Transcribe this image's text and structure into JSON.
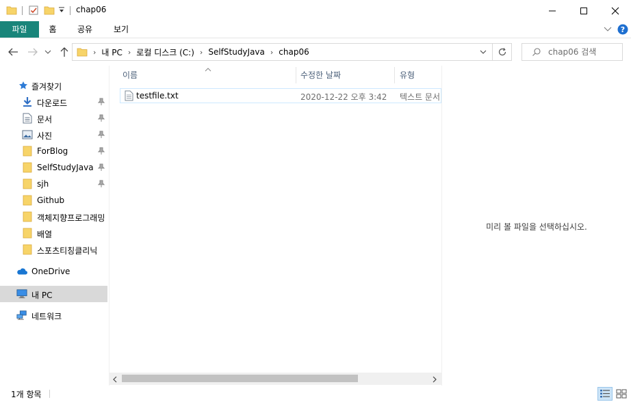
{
  "window": {
    "title": "chap06",
    "minimize_icon": "minimize-icon",
    "maximize_icon": "maximize-icon",
    "close_icon": "close-icon"
  },
  "ribbon": {
    "tabs": [
      {
        "label": "파일"
      },
      {
        "label": "홈"
      },
      {
        "label": "공유"
      },
      {
        "label": "보기"
      }
    ]
  },
  "address": {
    "crumbs": [
      "내 PC",
      "로컬 디스크 (C:)",
      "SelfStudyJava",
      "chap06"
    ]
  },
  "search": {
    "placeholder": "chap06 검색"
  },
  "nav": {
    "quick_access": "즐겨찾기",
    "items": [
      {
        "label": "다운로드",
        "icon": "download-icon"
      },
      {
        "label": "문서",
        "icon": "document-icon"
      },
      {
        "label": "사진",
        "icon": "picture-icon"
      },
      {
        "label": "ForBlog",
        "icon": "folder-icon"
      },
      {
        "label": "SelfStudyJava",
        "icon": "folder-icon"
      },
      {
        "label": "sjh",
        "icon": "folder-icon"
      },
      {
        "label": "Github",
        "icon": "folder-icon"
      },
      {
        "label": "객체지향프로그래밍",
        "icon": "folder-icon"
      },
      {
        "label": "배열",
        "icon": "folder-icon"
      },
      {
        "label": "스포츠티칭클리닉",
        "icon": "folder-icon"
      }
    ],
    "onedrive": "OneDrive",
    "thispc": "내 PC",
    "network": "네트워크"
  },
  "columns": {
    "name": "이름",
    "modified": "수정한 날짜",
    "type": "유형"
  },
  "files": [
    {
      "name": "testfile.txt",
      "modified": "2020-12-22 오후 3:42",
      "type": "텍스트 문서"
    }
  ],
  "preview": {
    "message": "미리 볼 파일을 선택하십시오."
  },
  "status": {
    "count": "1개 항목"
  },
  "colors": {
    "file_tab": "#19857a",
    "selection": "#cce8ff",
    "nav_selected": "#d9d9d9",
    "help": "#1e6fd0"
  }
}
